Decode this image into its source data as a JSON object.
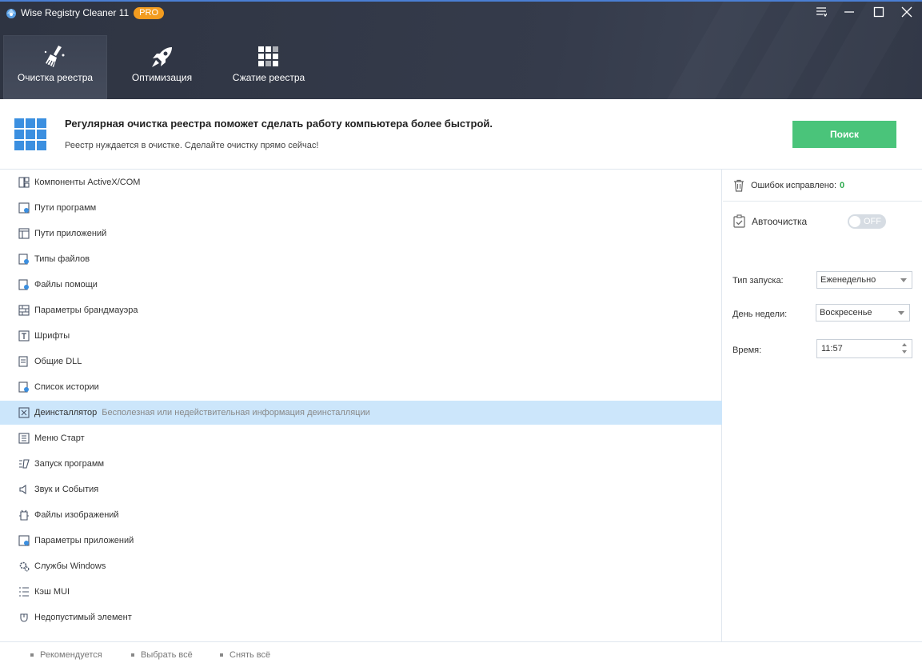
{
  "app": {
    "title": "Wise Registry Cleaner 11",
    "badge": "PRO"
  },
  "tabs": [
    {
      "label": "Очистка реестра",
      "icon": "broom-icon",
      "active": true
    },
    {
      "label": "Оптимизация",
      "icon": "rocket-icon",
      "active": false
    },
    {
      "label": "Сжатие реестра",
      "icon": "blocks-icon",
      "active": false
    }
  ],
  "banner": {
    "title": "Регулярная очистка реестра поможет сделать работу компьютера более быстрой.",
    "subtitle": "Реестр нуждается в очистке. Сделайте очистку прямо сейчас!",
    "button": "Поиск"
  },
  "categories": [
    {
      "label": "Компоненты ActiveX/COM",
      "icon": "activex-icon"
    },
    {
      "label": "Пути программ",
      "icon": "program-path-icon"
    },
    {
      "label": "Пути приложений",
      "icon": "app-path-icon"
    },
    {
      "label": "Типы файлов",
      "icon": "file-types-icon"
    },
    {
      "label": "Файлы помощи",
      "icon": "help-files-icon"
    },
    {
      "label": "Параметры брандмауэра",
      "icon": "firewall-icon"
    },
    {
      "label": "Шрифты",
      "icon": "font-icon"
    },
    {
      "label": "Общие DLL",
      "icon": "dll-icon"
    },
    {
      "label": "Список истории",
      "icon": "history-icon"
    },
    {
      "label": "Деинсталлятор",
      "icon": "uninstaller-icon",
      "description": "Бесполезная или недействительная информация деинсталляции",
      "selected": true
    },
    {
      "label": "Меню Старт",
      "icon": "start-menu-icon"
    },
    {
      "label": "Запуск программ",
      "icon": "startup-icon"
    },
    {
      "label": "Звук и События",
      "icon": "sound-icon"
    },
    {
      "label": "Файлы изображений",
      "icon": "image-files-icon"
    },
    {
      "label": "Параметры приложений",
      "icon": "app-settings-icon"
    },
    {
      "label": "Службы Windows",
      "icon": "services-icon"
    },
    {
      "label": "Кэш MUI",
      "icon": "mui-cache-icon"
    },
    {
      "label": "Недопустимый элемент",
      "icon": "invalid-item-icon"
    }
  ],
  "panel": {
    "fixed_label": "Ошибок исправлено:",
    "fixed_count": "0",
    "auto_label": "Автоочистка",
    "toggle": "OFF",
    "run_type_label": "Тип запуска:",
    "run_type_value": "Еженедельно",
    "weekday_label": "День недели:",
    "weekday_value": "Воскресенье",
    "time_label": "Время:",
    "time_value": "11:57"
  },
  "footer": {
    "recommended": "Рекомендуется",
    "select_all": "Выбрать всё",
    "deselect_all": "Снять всё"
  },
  "colors": {
    "accent": "#4ac47a",
    "header": "#323847",
    "selected_row": "#cce6fb",
    "badge": "#f39c1f",
    "count": "#2eaa4e"
  }
}
